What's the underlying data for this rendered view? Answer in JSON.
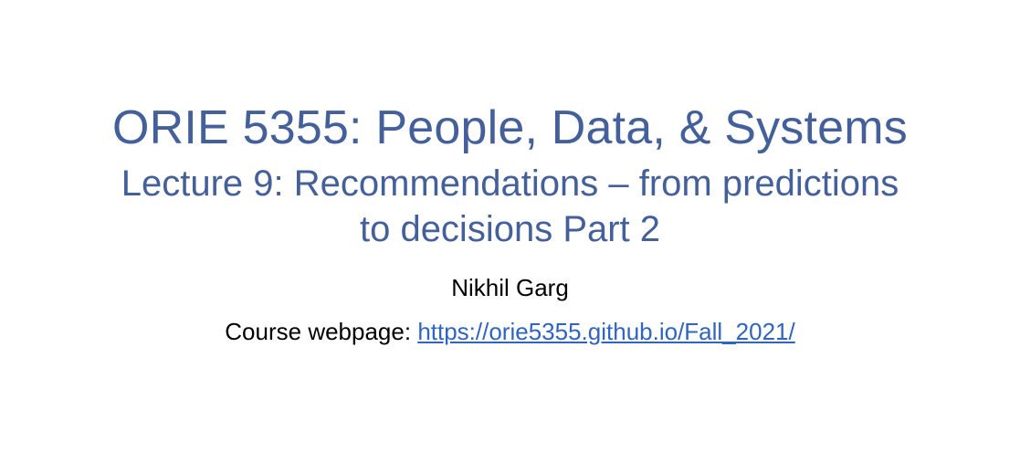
{
  "slide": {
    "title": "ORIE 5355: People, Data, & Systems",
    "subtitle_line1": "Lecture 9: Recommendations – from predictions",
    "subtitle_line2": "to decisions Part 2",
    "author": "Nikhil Garg",
    "course_label": "Course webpage: ",
    "course_url": "https://orie5355.github.io/Fall_2021/"
  },
  "colors": {
    "title": "#44609a",
    "link": "#2f64c2",
    "body": "#000000",
    "background": "#ffffff"
  }
}
